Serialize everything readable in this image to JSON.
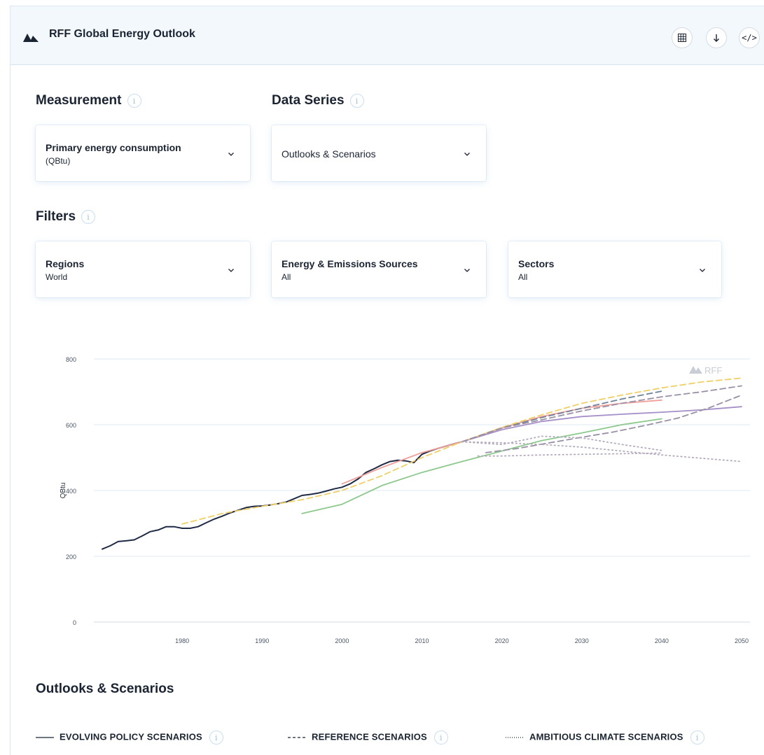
{
  "app": {
    "title": "RFF Global Energy Outlook"
  },
  "toolbar": {
    "icons": [
      "table-icon",
      "download-icon",
      "embed-code-icon"
    ],
    "embed_label": "</>"
  },
  "measurement": {
    "label": "Measurement",
    "selected_title": "Primary energy consumption",
    "selected_sub": "(QBtu)"
  },
  "data_series": {
    "label": "Data Series",
    "selected": "Outlooks & Scenarios"
  },
  "filters": {
    "label": "Filters",
    "regions": {
      "title": "Regions",
      "value": "World"
    },
    "sources": {
      "title": "Energy & Emissions Sources",
      "value": "All"
    },
    "sectors": {
      "title": "Sectors",
      "value": "All"
    }
  },
  "info_glyph": "i",
  "watermark": "RFF",
  "colors": {
    "accent": "#9fc3e6",
    "historical": "#1f2a44",
    "salmon": "#f0a09a",
    "purple": "#a690c8",
    "green": "#8cc98c",
    "gold": "#f2cf63",
    "gray": "#9a90a6"
  },
  "chart_data": {
    "type": "line",
    "ylabel": "QBtu",
    "ylim": [
      0,
      800
    ],
    "xlim": [
      1970,
      2050
    ],
    "y_ticks": [
      "0",
      "200",
      "400",
      "600",
      "800"
    ],
    "x_ticks": [
      "1980",
      "1990",
      "2000",
      "2010",
      "2020",
      "2030",
      "2040",
      "2050"
    ],
    "grid": true,
    "series": [
      {
        "color": "#1f2a44",
        "style": "solid",
        "x": [
          1970,
          1971,
          1972,
          1973,
          1974,
          1975,
          1976,
          1977,
          1978,
          1979,
          1980,
          1981,
          1982,
          1983,
          1984,
          1985,
          1986,
          1987,
          1988,
          1989,
          1990,
          1991,
          1992,
          1993,
          1994,
          1995,
          1996,
          1997,
          1998,
          1999,
          2000,
          2001,
          2002,
          2003,
          2004,
          2005,
          2006,
          2007,
          2008,
          2009,
          2010,
          2011,
          2012,
          2013,
          2014,
          2015
        ],
        "y": [
          222,
          232,
          245,
          247,
          250,
          262,
          275,
          280,
          290,
          290,
          285,
          285,
          290,
          302,
          313,
          322,
          332,
          340,
          348,
          352,
          353,
          356,
          360,
          365,
          375,
          385,
          388,
          392,
          398,
          405,
          410,
          420,
          435,
          455,
          466,
          478,
          488,
          492,
          490,
          485,
          510,
          520,
          528,
          535,
          542,
          548
        ]
      },
      {
        "color": "#f0a09a",
        "style": "solid",
        "x": [
          2000,
          2005,
          2010,
          2015,
          2020,
          2025,
          2030,
          2035,
          2040
        ],
        "y": [
          420,
          470,
          515,
          548,
          590,
          625,
          650,
          665,
          675
        ]
      },
      {
        "color": "#a690c8",
        "style": "solid",
        "x": [
          2015,
          2020,
          2025,
          2030,
          2035,
          2040,
          2045,
          2050
        ],
        "y": [
          548,
          585,
          610,
          625,
          632,
          638,
          645,
          655
        ]
      },
      {
        "color": "#8cc98c",
        "style": "solid",
        "x": [
          1995,
          2000,
          2005,
          2010,
          2015,
          2020,
          2025,
          2030,
          2035,
          2040
        ],
        "y": [
          330,
          358,
          415,
          455,
          488,
          520,
          552,
          575,
          600,
          618
        ]
      },
      {
        "color": "#f2cf63",
        "style": "dashed",
        "x": [
          1980,
          1985,
          1990,
          1995,
          2000,
          2005,
          2010,
          2015,
          2020,
          2025,
          2030,
          2035,
          2040,
          2045,
          2050
        ],
        "y": [
          298,
          330,
          352,
          372,
          400,
          445,
          500,
          548,
          592,
          630,
          665,
          690,
          712,
          730,
          742
        ]
      },
      {
        "color": "#6f8299",
        "style": "dashed",
        "x": [
          2015,
          2020,
          2025,
          2030,
          2035,
          2040
        ],
        "y": [
          548,
          590,
          622,
          650,
          678,
          702
        ]
      },
      {
        "color": "#9a90a6",
        "style": "dashed",
        "x": [
          2015,
          2020,
          2025,
          2030,
          2035,
          2040,
          2045,
          2050
        ],
        "y": [
          548,
          590,
          615,
          642,
          665,
          685,
          700,
          718
        ]
      },
      {
        "color": "#9a90a6",
        "style": "dashed",
        "x": [
          2018,
          2022,
          2026,
          2030,
          2034,
          2038,
          2042,
          2046,
          2050
        ],
        "y": [
          515,
          528,
          545,
          562,
          578,
          598,
          620,
          652,
          690
        ]
      },
      {
        "color": "#b4aabe",
        "style": "dotted",
        "x": [
          2015,
          2020,
          2025,
          2030,
          2035,
          2040,
          2045,
          2050
        ],
        "y": [
          548,
          545,
          540,
          532,
          520,
          508,
          498,
          488
        ]
      },
      {
        "color": "#b4aabe",
        "style": "dotted",
        "x": [
          2015,
          2020,
          2025,
          2030,
          2035,
          2040
        ],
        "y": [
          548,
          540,
          565,
          560,
          540,
          522
        ]
      },
      {
        "color": "#b4aabe",
        "style": "dotted",
        "x": [
          2017,
          2020,
          2025,
          2030,
          2035,
          2040
        ],
        "y": [
          505,
          505,
          508,
          510,
          512,
          514
        ]
      }
    ]
  },
  "legend": {
    "title": "Outlooks & Scenarios",
    "items": [
      {
        "label": "EVOLVING POLICY SCENARIOS",
        "style": "solid"
      },
      {
        "label": "REFERENCE SCENARIOS",
        "style": "dashed"
      },
      {
        "label": "AMBITIOUS CLIMATE SCENARIOS",
        "style": "dotted"
      }
    ]
  }
}
